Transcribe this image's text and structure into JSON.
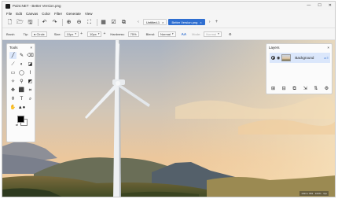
{
  "window": {
    "title": "Paint.NET - Better Version.png",
    "controls": {
      "minimize": "—",
      "maximize": "☐",
      "close": "✕"
    }
  },
  "menu": [
    "File",
    "Edit",
    "Canvas",
    "Color",
    "Filter",
    "Generate",
    "View"
  ],
  "toolbar": {
    "buttons": [
      {
        "name": "new-file-button",
        "glyph": "🗋"
      },
      {
        "name": "open-file-button",
        "glyph": "🗁"
      },
      {
        "name": "save-file-button",
        "glyph": "🖫"
      },
      {
        "name": "undo-button",
        "glyph": "↶"
      },
      {
        "name": "redo-button",
        "glyph": "↷"
      },
      {
        "name": "zoom-in-button",
        "glyph": "⊕"
      },
      {
        "name": "zoom-out-button",
        "glyph": "⊖"
      },
      {
        "name": "fit-window-button",
        "glyph": "⛶"
      },
      {
        "name": "grid-button",
        "glyph": "▦"
      },
      {
        "name": "checkbox-button",
        "glyph": "☑"
      },
      {
        "name": "resize-button",
        "glyph": "⧉"
      }
    ]
  },
  "tabs": [
    {
      "label": "Untitled-1",
      "close": "×",
      "active": false
    },
    {
      "label": "Better Version.png",
      "close": "×",
      "active": true
    }
  ],
  "tab_nav": {
    "prev": "‹",
    "next": "›",
    "add": "+"
  },
  "options": {
    "tool_label": "Brush",
    "tip_label": "Tip:",
    "tip_value": "Circle",
    "size_label": "Size:",
    "size_value": "10px",
    "spacing_value": "10px",
    "hardness_label": "Hardness:",
    "hardness_value": "75%",
    "blend_label": "Blend:",
    "blend_value": "Normal",
    "aa_label": "AA",
    "mode_label": "Mode:",
    "mode_value": "Normal",
    "plus": "+",
    "arrow": "▾"
  },
  "tools_panel": {
    "title": "Tools",
    "close": "×",
    "tools": [
      {
        "name": "pencil-tool",
        "glyph": "╱",
        "selected": true
      },
      {
        "name": "brush-tool",
        "glyph": "✎",
        "selected": false
      },
      {
        "name": "eraser-tool",
        "glyph": "⌫",
        "selected": false
      },
      {
        "name": "line-tool",
        "glyph": "⟋",
        "selected": false
      },
      {
        "name": "fill-tool",
        "glyph": "◐",
        "selected": false
      },
      {
        "name": "gradient-tool",
        "glyph": "◪",
        "selected": false
      },
      {
        "name": "rectangle-tool",
        "glyph": "▭",
        "selected": false
      },
      {
        "name": "ellipse-tool",
        "glyph": "◯",
        "selected": false
      },
      {
        "name": "lasso-tool",
        "glyph": "⌇",
        "selected": false
      },
      {
        "name": "magic-wand-tool",
        "glyph": "✧",
        "selected": false
      },
      {
        "name": "clone-stamp-tool",
        "glyph": "⚲",
        "selected": false
      },
      {
        "name": "recolor-tool",
        "glyph": "◩",
        "selected": false
      },
      {
        "name": "move-tool",
        "glyph": "✥",
        "selected": false
      },
      {
        "name": "select-tool",
        "glyph": "⬛",
        "selected": false
      },
      {
        "name": "crop-tool",
        "glyph": "⌗",
        "selected": false
      },
      {
        "name": "color-picker-tool",
        "glyph": "⚱",
        "selected": false
      },
      {
        "name": "text-tool",
        "glyph": "T",
        "selected": false
      },
      {
        "name": "zoom-tool",
        "glyph": "⌕",
        "selected": false
      },
      {
        "name": "pan-tool",
        "glyph": "✋",
        "selected": false
      },
      {
        "name": "shapes-tool",
        "glyph": "▲●",
        "selected": false
      }
    ],
    "swap_glyph": "⇄",
    "primary_color": "#000000",
    "secondary_color": "#ffffff"
  },
  "layers_panel": {
    "title": "Layers",
    "close": "×",
    "layers": [
      {
        "name": "Background",
        "visible": true,
        "props": "a ≡"
      }
    ],
    "actions": [
      {
        "name": "add-layer-button",
        "glyph": "⊞"
      },
      {
        "name": "delete-layer-button",
        "glyph": "⊟"
      },
      {
        "name": "duplicate-layer-button",
        "glyph": "⧉"
      },
      {
        "name": "merge-down-button",
        "glyph": "⇲"
      },
      {
        "name": "move-layer-button",
        "glyph": "⇅"
      },
      {
        "name": "layer-properties-button",
        "glyph": "⚙"
      }
    ]
  },
  "status": {
    "text": "1024 x 683 · 100% · 3px"
  },
  "colors": {
    "accent": "#2f6fd1",
    "panel_bg": "#fbfbfb",
    "chrome_bg": "#f3f3f3"
  }
}
